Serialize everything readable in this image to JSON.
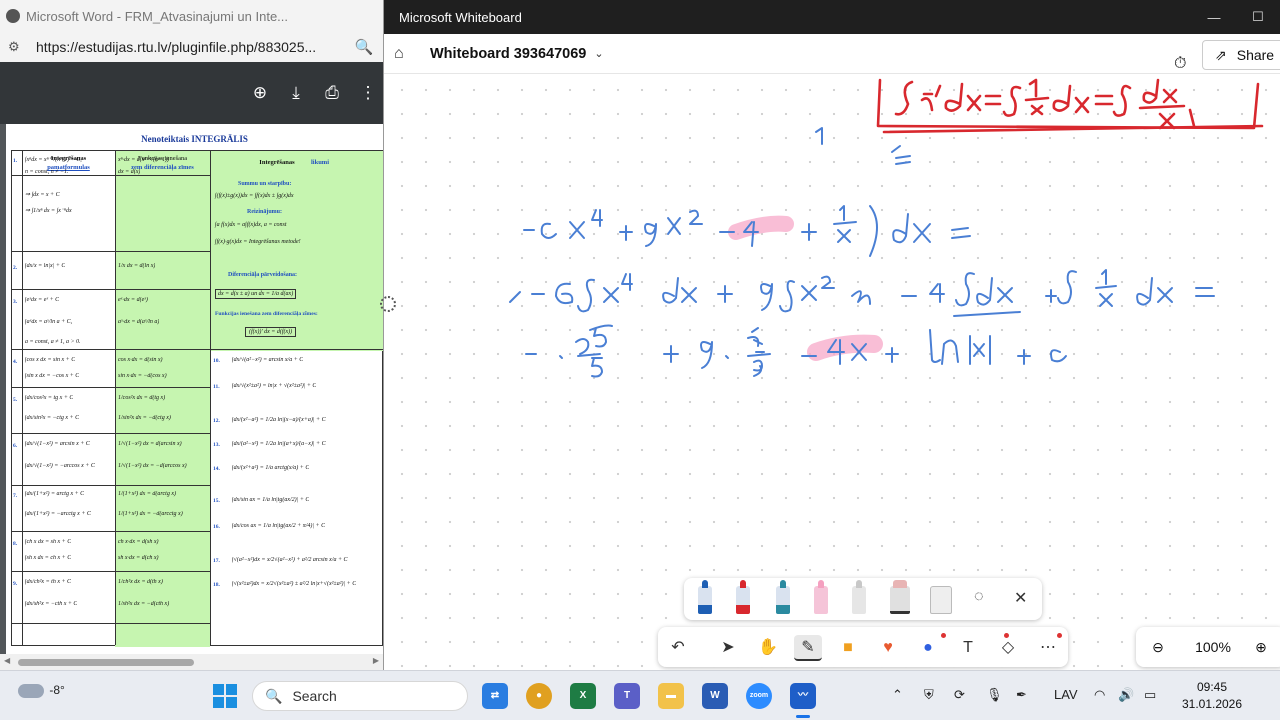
{
  "browser": {
    "tab_title": "Microsoft Word - FRM_Atvasinajumi un Inte...",
    "url": "https://estudijas.rtu.lv/pluginfile.php/883025...",
    "pdf": {
      "title": "Nenoteiktais INTEGRĀLIS",
      "col1_header": "Integrēšanas",
      "col1_header2": "pamatformulas",
      "col2_header": "Funkcijas ienešana",
      "col2_header2": "zem diferenciāļa zīmes",
      "col3_header": "Integrēšanas",
      "col3_header_blue": "likumi",
      "rule_sum": "Summu un starpību:",
      "rule_sum_formula": "∫(f(x)±g(x))dx = ∫f(x)dx ± ∫g(x)dx",
      "rule_product": "Reizinājumu:",
      "rule_product_formula1": "∫a f(x)dx = a∫f(x)dx,   a = const",
      "rule_product_formula2": "∫f(x)·g(x)dx = Integrēšanas metode!",
      "rule_transform": "Diferenciāļa pārveidošana:",
      "rule_transform_formula": "dx = d(x ± a)   un   dx = 1/a d(ax)",
      "rule_bring": "Funkcijas ienešana zem diferenciāļa zīmes:",
      "rule_bring_formula": "(f(x))′ dx = d(f(x))",
      "rows_left": [
        {
          "n": "1.",
          "a": "∫xⁿdx = xⁿ⁺¹/(n+1) + C,",
          "b": "xⁿ·dx = d(xⁿ⁺¹/(n+1))"
        },
        {
          "n": "",
          "a": "n = const, n ≠ −1.",
          "b": "dx = d(x)"
        },
        {
          "n": "",
          "a": "⇒ ∫dx = x + C",
          "b": ""
        },
        {
          "n": "",
          "a": "⇒ ∫1/xⁿ dx = ∫x⁻ⁿdx",
          "b": ""
        },
        {
          "n": "2.",
          "a": "∫dx/x = ln|x| + C",
          "b": "1/x dx = d(ln x)"
        },
        {
          "n": "3.",
          "a": "∫eˣdx = eˣ + C",
          "b": "eˣ·dx = d(eˣ)"
        },
        {
          "n": "",
          "a": "∫aˣdx = aˣ/ln a + C,",
          "b": "aˣ·dx = d(aˣ/ln a)"
        },
        {
          "n": "",
          "a": "a = const, a ≠ 1, a > 0.",
          "b": ""
        },
        {
          "n": "4.",
          "a": "∫cos x dx = sin x + C",
          "b": "cos x·dx = d(sin x)"
        },
        {
          "n": "",
          "a": "∫sin x dx = −cos x + C",
          "b": "sin x·dx = −d(cos x)"
        },
        {
          "n": "5.",
          "a": "∫dx/cos²x = tg x + C",
          "b": "1/cos²x dx = d(tg x)"
        },
        {
          "n": "",
          "a": "∫dx/sin²x = −ctg x + C",
          "b": "1/sin²x dx = −d(ctg x)"
        },
        {
          "n": "6.",
          "a": "∫dx/√(1−x²) = arcsin x + C",
          "b": "1/√(1−x²) dx = d(arcsin x)"
        },
        {
          "n": "",
          "a": "∫dx/√(1−x²) = −arccos x + C",
          "b": "1/√(1−x²) dx = −d(arccos x)"
        },
        {
          "n": "7.",
          "a": "∫dx/(1+x²) = arctg x + C",
          "b": "1/(1+x²) dx = d(arctg x)"
        },
        {
          "n": "",
          "a": "∫dx/(1+x²) = −arcctg x + C",
          "b": "1/(1+x²) dx = −d(arcctg x)"
        },
        {
          "n": "8.",
          "a": "∫ch x dx = sh x + C",
          "b": "ch x·dx = d(sh x)"
        },
        {
          "n": "",
          "a": "∫sh x dx = ch x + C",
          "b": "sh x·dx = d(ch x)"
        },
        {
          "n": "9.",
          "a": "∫dx/ch²x = th x + C",
          "b": "1/ch²x dx = d(th x)"
        },
        {
          "n": "",
          "a": "∫dx/sh²x = −cth x + C",
          "b": "1/sh²x dx = −d(cth x)"
        }
      ],
      "rows_right": [
        {
          "n": "10.",
          "f": "∫dx/√(a²−x²) = arcsin x/a + C"
        },
        {
          "n": "11.",
          "f": "∫dx/√(x²±a²) = ln|x + √(x²±a²)| + C"
        },
        {
          "n": "12.",
          "f": "∫dx/(x²−a²) = 1/2a ln|(x−a)/(x+a)| + C"
        },
        {
          "n": "13.",
          "f": "∫dx/(a²−x²) = 1/2a ln|(a+x)/(a−x)| + C"
        },
        {
          "n": "14.",
          "f": "∫dx/(x²+a²) = 1/a arctg(x/a) + C"
        },
        {
          "n": "15.",
          "f": "∫dx/sin ax = 1/a ln|tg(ax/2)| + C"
        },
        {
          "n": "16.",
          "f": "∫dx/cos ax = 1/a ln|tg(ax/2 + π/4)| + C"
        },
        {
          "n": "17.",
          "f": "∫√(a²−x²)dx = x/2√(a²−x²) + a²/2 arcsin x/a + C"
        },
        {
          "n": "18.",
          "f": "∫√(x²±a²)dx = x/2√(x²±a²) ± a²/2 ln|x+√(x²±a²)| + C"
        }
      ]
    }
  },
  "whiteboard": {
    "window_title": "Microsoft Whiteboard",
    "board_name": "Whiteboard 393647069",
    "share_label": "Share",
    "zoom_level": "100%",
    "ink_color_red": "#d8282e",
    "ink_color_blue": "#4a7fd4",
    "ink_color_pink": "#f7a8c8",
    "pens": [
      {
        "name": "blue-pen",
        "color": "#1e5fb4"
      },
      {
        "name": "red-pen",
        "color": "#d8282e"
      },
      {
        "name": "teal-pen",
        "color": "#2a8aa0"
      },
      {
        "name": "pink-highlighter",
        "color": "#f5a0c0"
      },
      {
        "name": "gray-pen",
        "color": "#c8c8c8"
      },
      {
        "name": "eraser",
        "color": "#e8b4b4"
      }
    ]
  },
  "taskbar": {
    "temperature": "-8°",
    "search_placeholder": "Search",
    "language": "LAV",
    "time": "09:45",
    "date": "31.01.2026"
  }
}
